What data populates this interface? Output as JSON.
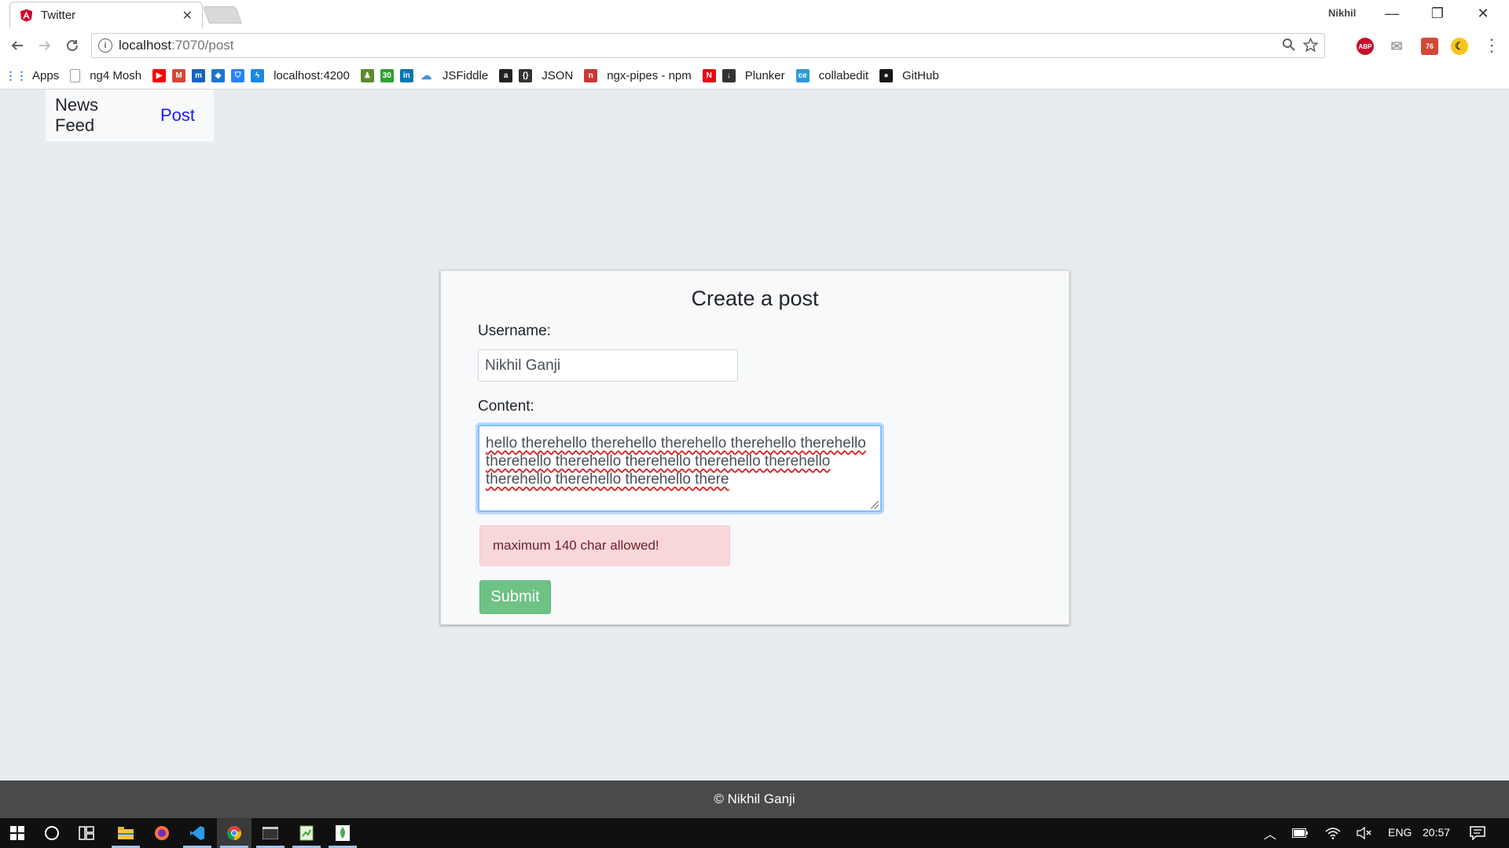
{
  "browser": {
    "tab_title": "Twitter",
    "tab_close": "✕",
    "profile_name": "Nikhil",
    "window_controls": {
      "minimize": "—",
      "restore": "❐",
      "close": "✕"
    },
    "url_host": "localhost",
    "url_path": ":7070/post",
    "bookmarks": [
      {
        "label": "Apps",
        "icon": "apps-grid-icon",
        "color": "#1a73e8"
      },
      {
        "label": "ng4 Mosh",
        "icon": "page-icon",
        "color": "#9e9e9e"
      },
      {
        "label": "",
        "icon": "youtube-icon",
        "color": "#ff0000"
      },
      {
        "label": "",
        "icon": "gmail-icon",
        "color": "#d44638"
      },
      {
        "label": "",
        "icon": "m-icon",
        "color": "#1565c0"
      },
      {
        "label": "",
        "icon": "diamond-icon",
        "color": "#1976d2"
      },
      {
        "label": "",
        "icon": "bitbucket-icon",
        "color": "#2684ff"
      },
      {
        "label": "localhost:4200",
        "icon": "bolt-icon",
        "color": "#1e88e5"
      },
      {
        "label": "",
        "icon": "chess-icon",
        "color": "#5d8a2e"
      },
      {
        "label": "",
        "icon": "30-icon",
        "color": "#2ea12e"
      },
      {
        "label": "",
        "icon": "linkedin-icon",
        "color": "#0077b5"
      },
      {
        "label": "JSFiddle",
        "icon": "cloud-icon",
        "color": "#4a90d9"
      },
      {
        "label": "",
        "icon": "amazon-icon",
        "color": "#222222"
      },
      {
        "label": "JSON",
        "icon": "braces-icon",
        "color": "#333333"
      },
      {
        "label": "ngx-pipes - npm",
        "icon": "npm-icon",
        "color": "#cb3837"
      },
      {
        "label": "",
        "icon": "netflix-icon",
        "color": "#e50914"
      },
      {
        "label": "Plunker",
        "icon": "download-icon",
        "color": "#333333"
      },
      {
        "label": "collabedit",
        "icon": "ce-icon",
        "color": "#2e9bd6"
      },
      {
        "label": "GitHub",
        "icon": "github-icon",
        "color": "#181717"
      }
    ],
    "extensions": [
      {
        "icon": "adblock-icon",
        "text": "ABP",
        "color": "#c8102e"
      },
      {
        "icon": "mail-icon",
        "text": "✉",
        "color": "#9e9e9e"
      },
      {
        "icon": "gmail-checker-icon",
        "text": "76",
        "color": "#d44638"
      },
      {
        "icon": "moon-icon",
        "text": "☾",
        "color": "#f9c51b"
      }
    ]
  },
  "app": {
    "nav": {
      "news_feed": "News Feed",
      "post": "Post"
    },
    "form": {
      "title": "Create a post",
      "username_label": "Username:",
      "username_value": "Nikhil Ganji",
      "content_label": "Content:",
      "content_value": "hello therehello therehello therehello therehello therehello therehello therehello therehello therehello therehello therehello therehello therehello there",
      "error_message": "maximum 140 char allowed!",
      "submit_label": "Submit"
    },
    "footer": "© Nikhil Ganji",
    "colors": {
      "submit": "#6dc284",
      "alert_bg": "#f8d7da",
      "alert_text": "#721c24",
      "nav_active": "#1a1aff",
      "focus_border": "#80bdff"
    }
  },
  "taskbar": {
    "language": "ENG",
    "time": "20:57"
  }
}
